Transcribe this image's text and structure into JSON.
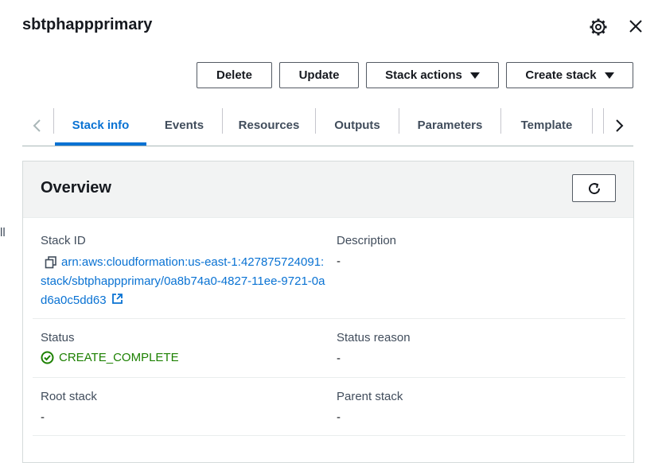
{
  "header": {
    "title": "sbtphappprimary",
    "settings_icon": "gear-icon",
    "close_icon": "close-icon"
  },
  "toolbar": {
    "delete_label": "Delete",
    "update_label": "Update",
    "stack_actions_label": "Stack actions",
    "create_stack_label": "Create stack"
  },
  "tabs": {
    "items": [
      {
        "label": "Stack info",
        "active": true
      },
      {
        "label": "Events"
      },
      {
        "label": "Resources"
      },
      {
        "label": "Outputs"
      },
      {
        "label": "Parameters"
      },
      {
        "label": "Template"
      }
    ]
  },
  "overview": {
    "title": "Overview",
    "stack_id_label": "Stack ID",
    "stack_id_value": "arn:aws:cloudformation:us-east-1:427875724091:stack/sbtphappprimary/0a8b74a0-4827-11ee-9721-0ad6a0c5dd63",
    "description_label": "Description",
    "description_value": "-",
    "status_label": "Status",
    "status_value": "CREATE_COMPLETE",
    "status_reason_label": "Status reason",
    "status_reason_value": "-",
    "root_stack_label": "Root stack",
    "root_stack_value": "-",
    "parent_stack_label": "Parent stack",
    "parent_stack_value": "-"
  },
  "colors": {
    "link": "#0972d3",
    "success": "#1d8102",
    "text": "#16191f"
  }
}
